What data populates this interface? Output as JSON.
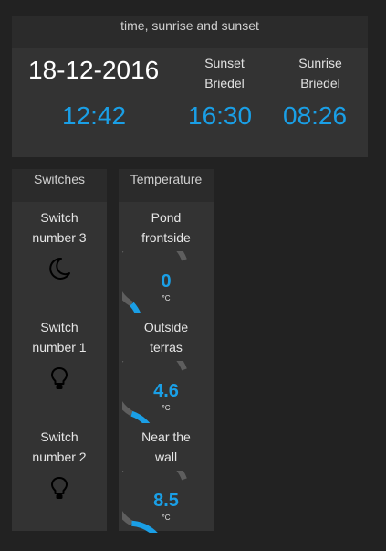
{
  "time_panel": {
    "title": "time, sunrise and sunset",
    "date": "18-12-2016",
    "time": "12:42",
    "sunset_label_1": "Sunset",
    "sunset_label_2": "Briedel",
    "sunset_time": "16:30",
    "sunrise_label_1": "Sunrise",
    "sunrise_label_2": "Briedel",
    "sunrise_time": "08:26"
  },
  "switches": {
    "title": "Switches",
    "items": [
      {
        "label_1": "Switch",
        "label_2": "number 3",
        "icon": "moon-icon"
      },
      {
        "label_1": "Switch",
        "label_2": "number 1",
        "icon": "lightbulb-icon"
      },
      {
        "label_1": "Switch",
        "label_2": "number 2",
        "icon": "lightbulb-icon"
      }
    ]
  },
  "temperature": {
    "title": "Temperature",
    "items": [
      {
        "label_1": "Pond",
        "label_2": "frontside",
        "value": "0",
        "unit": "°C",
        "level": 0.1
      },
      {
        "label_1": "Outside",
        "label_2": "terras",
        "value": "4.6",
        "unit": "°C",
        "level": 0.23
      },
      {
        "label_1": "Near the",
        "label_2": "wall",
        "value": "8.5",
        "unit": "°C",
        "level": 0.3
      }
    ]
  },
  "colors": {
    "accent": "#1a9fe6",
    "background": "#222222",
    "panel": "#333333",
    "gauge_track": "#5e5e5e"
  }
}
